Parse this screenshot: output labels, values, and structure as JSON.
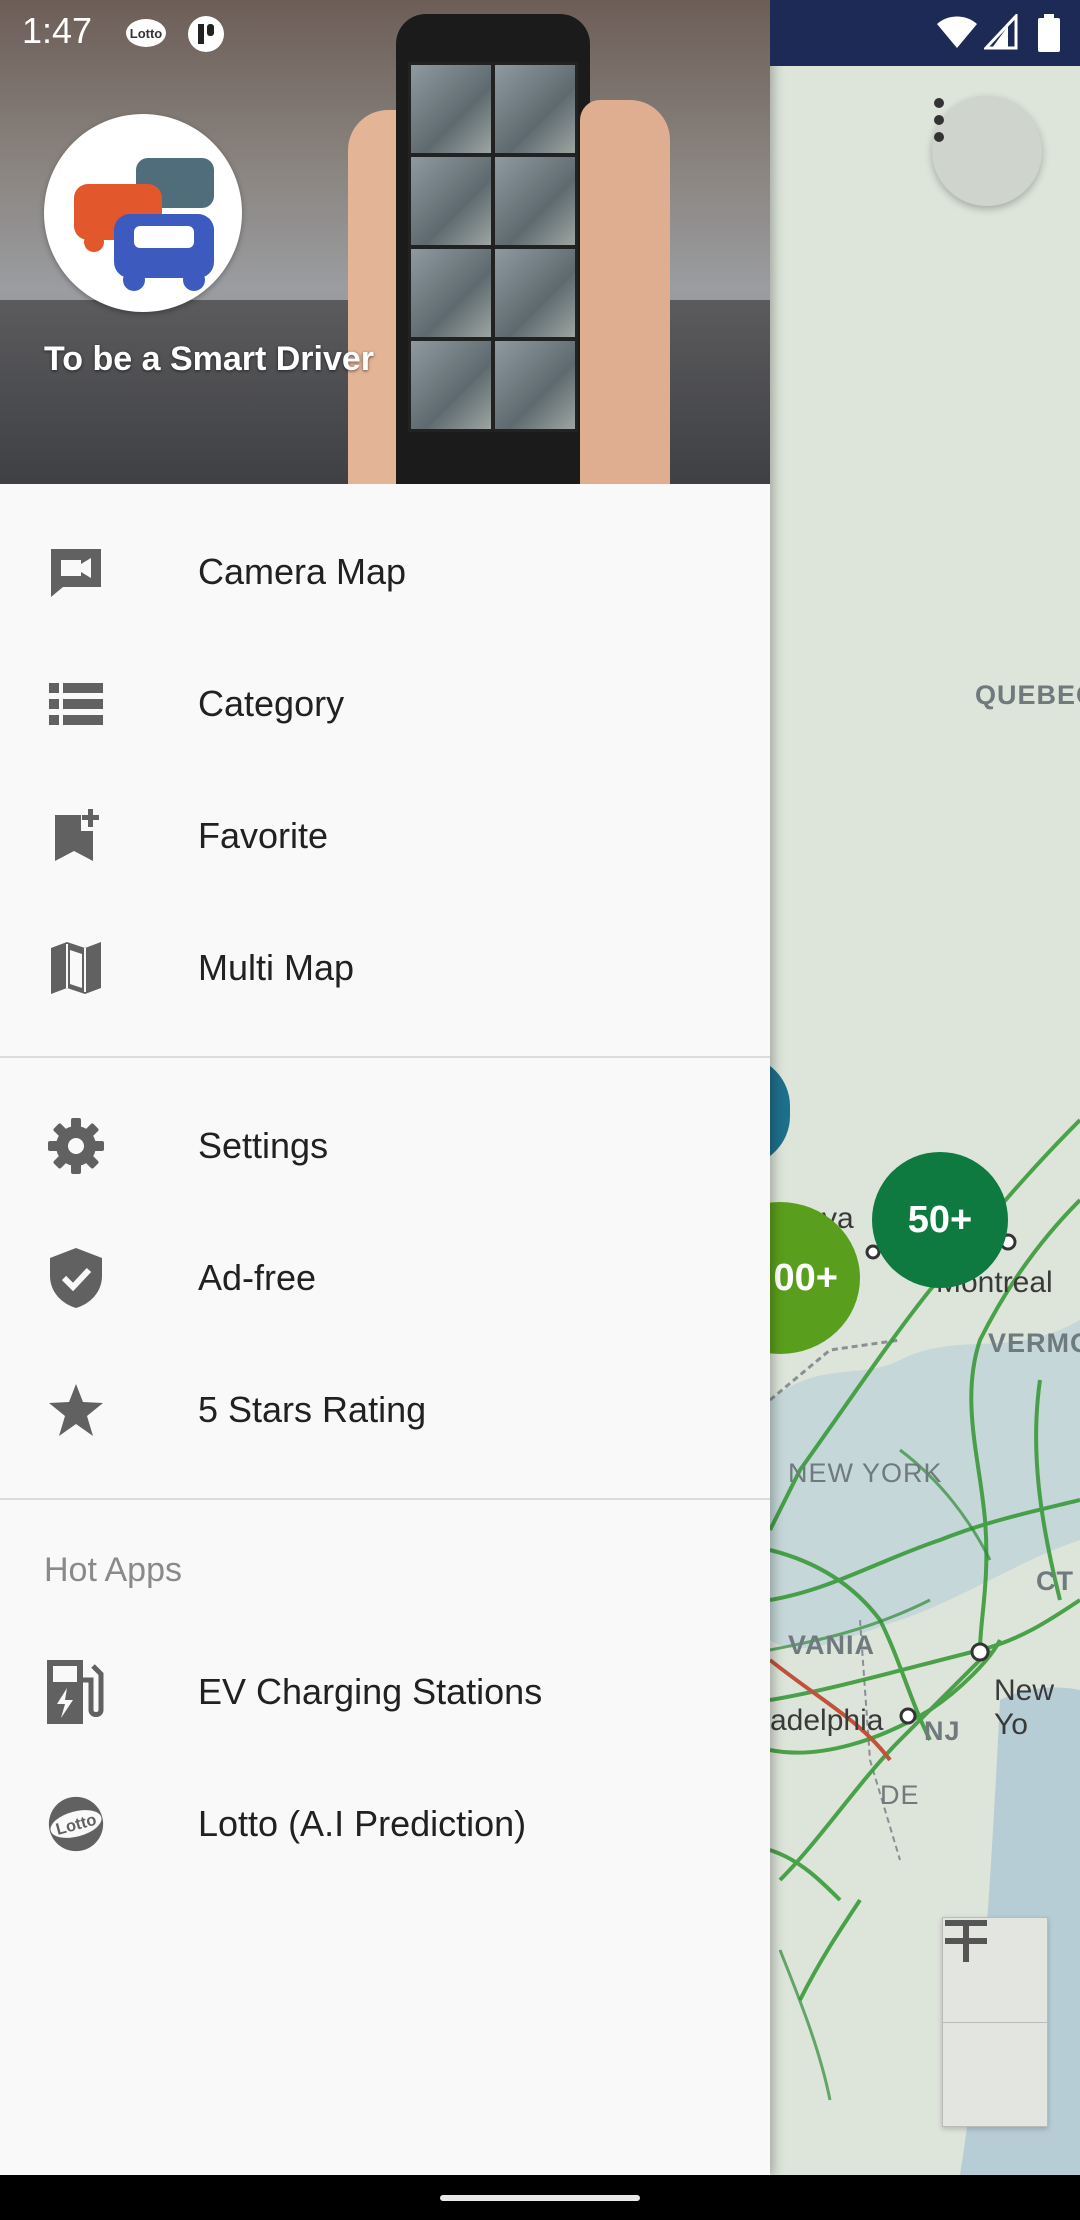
{
  "status_bar": {
    "time": "1:47",
    "notification_icons": [
      "lotto-icon",
      "app-icon"
    ],
    "system_icons": [
      "wifi-icon",
      "signal-icon",
      "battery-icon"
    ]
  },
  "drawer": {
    "header": {
      "tagline": "To be a Smart Driver"
    },
    "main_items": [
      {
        "label": "Camera Map",
        "icon": "videocam-icon"
      },
      {
        "label": "Category",
        "icon": "list-icon"
      },
      {
        "label": "Favorite",
        "icon": "bookmark-add-icon"
      },
      {
        "label": "Multi Map",
        "icon": "map-icon"
      }
    ],
    "secondary_items": [
      {
        "label": "Settings",
        "icon": "gear-icon"
      },
      {
        "label": "Ad-free",
        "icon": "shield-check-icon"
      },
      {
        "label": "5 Stars Rating",
        "icon": "star-icon"
      }
    ],
    "hot_apps": {
      "title": "Hot Apps",
      "items": [
        {
          "label": "EV Charging Stations",
          "icon": "ev-station-icon"
        },
        {
          "label": "Lotto (A.I Prediction)",
          "icon": "lotto-icon"
        }
      ]
    }
  },
  "map": {
    "region_labels": [
      "QUEBEC",
      "VERMO",
      "NEW YORK",
      "VANIA",
      "CT",
      "NJ",
      "DE"
    ],
    "city_labels": [
      "Montreal",
      "New Yo",
      "adelphia",
      "va"
    ],
    "clusters": [
      {
        "label": "50+",
        "color": "#0f7a3f"
      },
      {
        "label": "00+",
        "color": "#5a9e1d"
      }
    ]
  },
  "colors": {
    "status_bar_bg": "#1d2a55",
    "drawer_bg": "#f9f9f9",
    "icon_color": "#616161",
    "route_green": "#3a9a3a"
  }
}
